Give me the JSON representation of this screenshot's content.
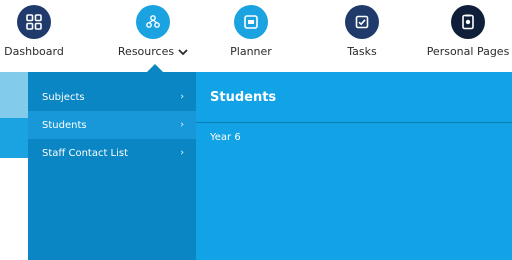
{
  "nav": {
    "items": [
      {
        "label": "Dashboard",
        "icon": "grid-icon",
        "color": "#1f3a6b"
      },
      {
        "label": "Resources",
        "icon": "resources-icon",
        "color": "#1aa3e0",
        "has_dropdown": true
      },
      {
        "label": "Planner",
        "icon": "planner-icon",
        "color": "#1aa3e0"
      },
      {
        "label": "Tasks",
        "icon": "checkbox-icon",
        "color": "#1f3a6b"
      },
      {
        "label": "Personal Pages",
        "icon": "personal-pages-icon",
        "color": "#0f1f3a"
      }
    ]
  },
  "menu": {
    "items": [
      {
        "label": "Subjects",
        "arrow": "›"
      },
      {
        "label": "Students",
        "arrow": "›",
        "active": true
      },
      {
        "label": "Staff Contact List",
        "arrow": "›"
      }
    ],
    "background": "#0b86c4",
    "active_background": "#1898d8"
  },
  "panel": {
    "title": "Students",
    "items": [
      "Year 6"
    ],
    "background": "#11a3e6"
  }
}
